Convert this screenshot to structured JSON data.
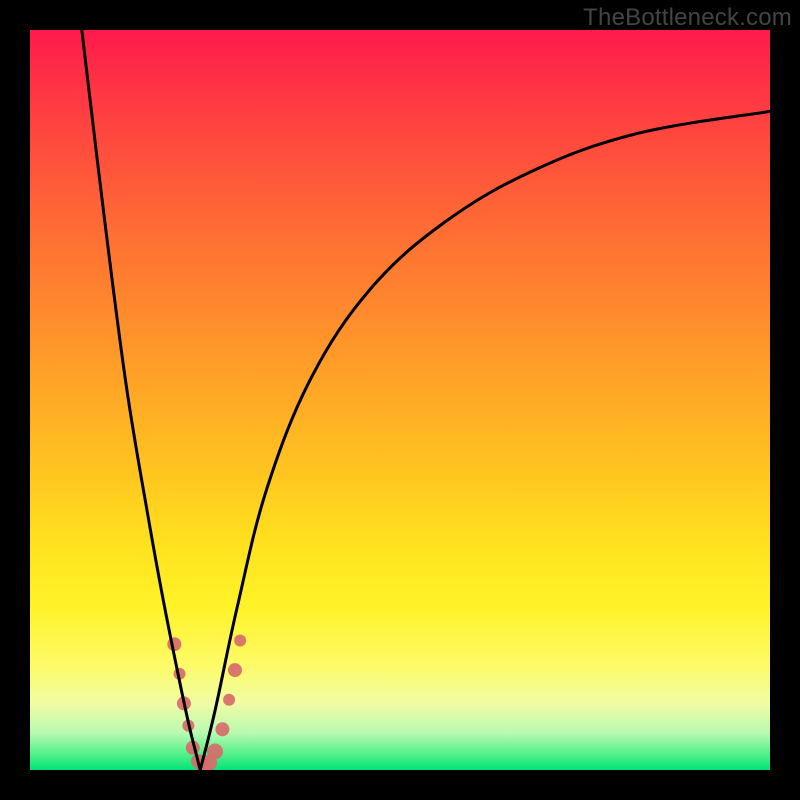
{
  "watermark": "TheBottleneck.com",
  "chart_data": {
    "type": "line",
    "title": "",
    "xlabel": "",
    "ylabel": "",
    "xlim": [
      0,
      100
    ],
    "ylim": [
      0,
      100
    ],
    "gradient_colors": {
      "top": "#ff1a4b",
      "mid_upper": "#ff8a2d",
      "mid": "#ffe31e",
      "mid_lower": "#fdfb6a",
      "bottom": "#00e47a"
    },
    "series": [
      {
        "name": "left-branch",
        "x": [
          7,
          10,
          13,
          16,
          18,
          20,
          21.5,
          22.5,
          23
        ],
        "y": [
          100,
          75,
          52,
          34,
          23,
          13,
          6,
          2,
          0
        ]
      },
      {
        "name": "right-branch",
        "x": [
          23,
          25,
          28,
          32,
          38,
          46,
          56,
          68,
          82,
          100
        ],
        "y": [
          0,
          8,
          22,
          38,
          53,
          65,
          74,
          81,
          86,
          89
        ]
      }
    ],
    "markers": {
      "name": "highlight-dots",
      "color": "#d76b6b",
      "points": [
        {
          "x": 19.5,
          "y": 17,
          "r": 7
        },
        {
          "x": 20.2,
          "y": 13,
          "r": 6
        },
        {
          "x": 20.8,
          "y": 9,
          "r": 7
        },
        {
          "x": 21.4,
          "y": 6,
          "r": 6
        },
        {
          "x": 22.0,
          "y": 3,
          "r": 7
        },
        {
          "x": 22.7,
          "y": 1.2,
          "r": 7
        },
        {
          "x": 23.4,
          "y": 0.6,
          "r": 8
        },
        {
          "x": 24.2,
          "y": 1.0,
          "r": 8
        },
        {
          "x": 25.0,
          "y": 2.5,
          "r": 8
        },
        {
          "x": 26.0,
          "y": 5.5,
          "r": 7
        },
        {
          "x": 26.9,
          "y": 9.5,
          "r": 6
        },
        {
          "x": 27.7,
          "y": 13.5,
          "r": 7
        },
        {
          "x": 28.4,
          "y": 17.5,
          "r": 6
        }
      ]
    },
    "minimum_at_x": 23
  }
}
